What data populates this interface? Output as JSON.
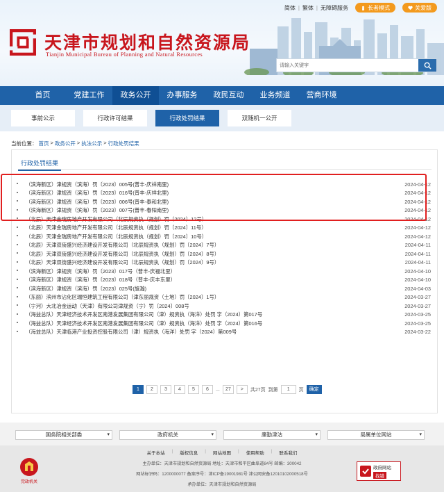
{
  "header": {
    "title": "天津市规划和自然资源局",
    "subtitle": "Tianjin Municipal Bureau of Planning and Natural Resources",
    "top_links": [
      "简体",
      "繁体",
      "无障碍服务"
    ],
    "elder_mode": "长者模式",
    "care_version": "关爱版",
    "search_placeholder": "请输入关键字"
  },
  "nav": {
    "items": [
      "首页",
      "党建工作",
      "政务公开",
      "办事服务",
      "政民互动",
      "业务频道",
      "营商环境"
    ]
  },
  "subnav": {
    "items": [
      "事前公示",
      "行政许可结果",
      "行政处罚结果",
      "双随机一公开"
    ]
  },
  "breadcrumb": {
    "prefix": "当前位置：",
    "items": [
      "首页",
      "政务公开",
      "执法公示",
      "行政处罚结果"
    ],
    "separator": ">"
  },
  "content": {
    "tab": "行政处罚结果",
    "rows": [
      {
        "title": "（滨海新区）津规资（滨海）罚〔2023〕005号(普丰-庆祥南里)",
        "date": "2024-04-12"
      },
      {
        "title": "（滨海新区）津规资（滨海）罚〔2023〕016号(普丰-庆祥北里)",
        "date": "2024-04-12"
      },
      {
        "title": "（滨海新区）津规资（滨海）罚〔2023〕006号(普丰-泰和北里)",
        "date": "2024-04-12"
      },
      {
        "title": "（滨海新区）津规资（滨海）罚〔2023〕007号(普丰-春阳南里)",
        "date": "2024-04-12"
      },
      {
        "title": "（北辰）天津金瑞房地产开发有限公司（北辰规资执（规划）罚〔2024〕12号）",
        "date": "2024-04-12"
      },
      {
        "title": "（北辰）天津金瑞房地产开发有限公司（北辰规资执（规划）罚〔2024〕11号）",
        "date": "2024-04-12"
      },
      {
        "title": "（北辰）天津金瑞房地产开发有限公司（北辰规资执（规划）罚〔2024〕10号）",
        "date": "2024-04-12"
      },
      {
        "title": "（北辰）天津双街盛兴经济建设开发有限公司（北辰规资执（规划）罚〔2024〕7号）",
        "date": "2024-04-11"
      },
      {
        "title": "（北辰）天津双街盛兴经济建设开发有限公司（北辰规资执（规划）罚〔2024〕8号）",
        "date": "2024-04-11"
      },
      {
        "title": "（北辰）天津双街盛兴经济建设开发有限公司（北辰规资执（规划）罚〔2024〕9号）",
        "date": "2024-04-11"
      },
      {
        "title": "（滨海新区）津规资（滨海）罚〔2023〕017号（普丰-庆福北里）",
        "date": "2024-04-10"
      },
      {
        "title": "（滨海新区）津规资（滨海）罚〔2023〕018号（普丰-庆丰东里）",
        "date": "2024-04-10"
      },
      {
        "title": "（滨海新区）津规资（滨海）罚〔2023〕025号(旗瀚)",
        "date": "2024-04-03"
      },
      {
        "title": "（东丽）滨州市沾化区瑞恒建筑工程有限公司（津东丽规资（土地）罚〔2024〕1号）",
        "date": "2024-03-27"
      },
      {
        "title": "（宁河）大北冶金运动（天津）有限公司津规资（宁）罚〔2024〕008号",
        "date": "2024-03-27"
      },
      {
        "title": "（海益总队）天津经济技术开发区南港发展集团有限公司（津）规资执（海洋）处罚 字（2024）第017号",
        "date": "2024-03-25"
      },
      {
        "title": "（海益总队）天津经济技术开发区南港发展集团有限公司（津）规资执（海洋）处罚 字（2024）第016号",
        "date": "2024-03-25"
      },
      {
        "title": "（海益总队）天津临港产业投资控股有限公司（津）规资执（海洋）处罚 字（2024）第009号",
        "date": "2024-03-22"
      }
    ]
  },
  "pager": {
    "pages": [
      "1",
      "2",
      "3",
      "4",
      "5",
      "6",
      "...",
      "27",
      ">"
    ],
    "current": "1",
    "total_text": "共27页",
    "jump_label": "到第",
    "jump_value": "1",
    "page_unit": "页",
    "go_label": "确定"
  },
  "footer": {
    "selects": [
      "国务院相关部委",
      "政府机关",
      "廉勤津沽",
      "局属单位网站"
    ],
    "links": [
      "关于本站",
      "版权信息",
      "网站地图",
      "使用帮助",
      "联系我们"
    ],
    "sponsor": "主办单位：天津市规划和自然资源局  地址：天津市和平区曲阜道84号  邮编：300042",
    "record": "网站标识码：1200000077  备案序号：津ICP备19001981号    津公网安备12010102000518号",
    "maintainer": "承办单位：天津市规划和自然资源局",
    "badge_left": "党政机关",
    "badge_right_top": "政府网站",
    "badge_right_bottom": "找错"
  },
  "colors": {
    "brand_red": "#c8161d",
    "nav_blue": "#1f62a8",
    "highlight_red": "#e11f1f",
    "elder_orange": "#f39a1e"
  }
}
